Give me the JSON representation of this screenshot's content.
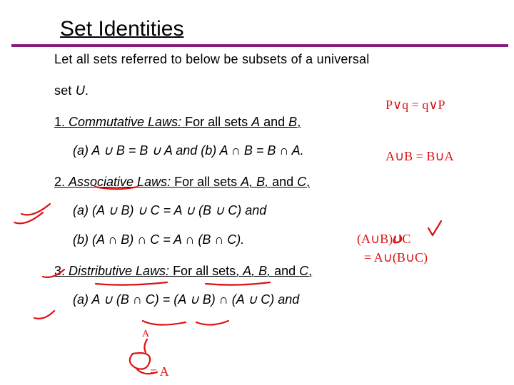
{
  "title": "Set Identities",
  "intro_l1": "Let all sets referred to below be subsets of a universal",
  "intro_l2_pre": "set ",
  "intro_l2_U": "U",
  "intro_l2_post": ".",
  "law1_prefix": "1. ",
  "law1_name": "Commutative Laws:",
  "law1_rest_pre": " For all sets ",
  "law1_rest_A": "A",
  "law1_rest_mid": " and ",
  "law1_rest_B": "B",
  "law1_rest_end": ",",
  "law1_sub": "(a)  A  ∪  B = B  ∪  A and (b) A ∩ B = B ∩ A.",
  "law2_prefix": "2. ",
  "law2_name": "Associative Laws:",
  "law2_rest_pre": " For all sets ",
  "law2_rest_ABC": "A, B,",
  "law2_rest_and": " and ",
  "law2_rest_C": "C",
  "law2_rest_end": ",",
  "law2_sub_a": "(a)  (A  ∪  B)  ∪  C = A  ∪  (B  ∪  C) and",
  "law2_sub_b": "(b)  (A ∩ B) ∩ C = A ∩ (B ∩ C).",
  "law3_prefix": "3. ",
  "law3_name": "Distributive Laws:",
  "law3_rest_pre": " For all sets, ",
  "law3_rest_ABC": "A, B,",
  "law3_rest_and": " and ",
  "law3_rest_C": "C",
  "law3_rest_end": ",",
  "law3_sub_a": "(a)  A  ∪  (B ∩ C) = (A  ∪  B) ∩ (A  ∪  C) and",
  "annot": {
    "pvq": "P∨q = q∨P",
    "aub_l1": "A∪B = B∪A",
    "aubuc_l1": "(A∪B)∪C",
    "aubuc_l2": "= A∪(B∪C)",
    "top_A": "A",
    "eqA": "= A"
  }
}
